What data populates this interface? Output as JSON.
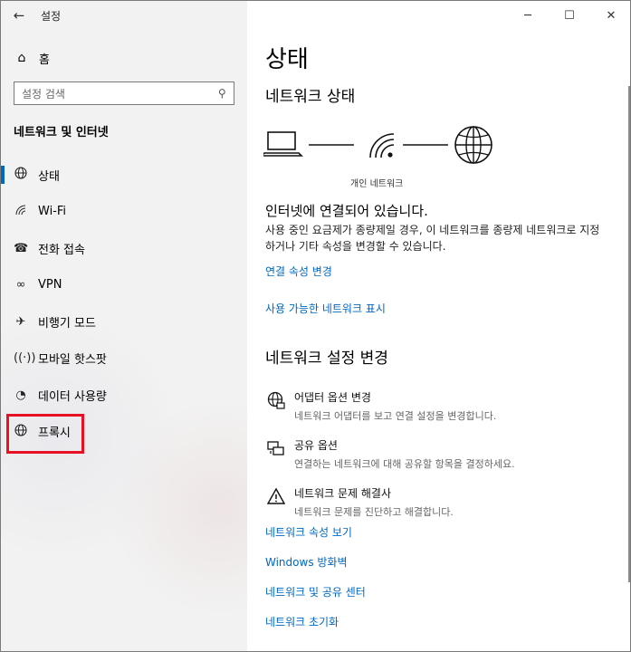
{
  "app": {
    "title": "설정"
  },
  "sidebar": {
    "home_label": "홈",
    "search_placeholder": "설정 검색",
    "section_title": "네트워크 및 인터넷",
    "items": [
      {
        "label": "상태",
        "icon": "globe-status-icon",
        "active": true
      },
      {
        "label": "Wi-Fi",
        "icon": "wifi-icon"
      },
      {
        "label": "전화 접속",
        "icon": "dialup-icon"
      },
      {
        "label": "VPN",
        "icon": "vpn-icon"
      },
      {
        "label": "비행기 모드",
        "icon": "airplane-icon"
      },
      {
        "label": "모바일 핫스팟",
        "icon": "hotspot-icon"
      },
      {
        "label": "데이터 사용량",
        "icon": "data-usage-icon"
      },
      {
        "label": "프록시",
        "icon": "globe-icon"
      }
    ]
  },
  "main": {
    "page_title": "상태",
    "network_status_heading": "네트워크 상태",
    "network_caption": "개인 네트워크",
    "connected_title": "인터넷에 연결되어 있습니다.",
    "connected_desc": "사용 중인 요금제가 종량제일 경우, 이 네트워크를 종량제 네트워크로 지정하거나 기타 속성을 변경할 수 있습니다.",
    "link_change_props": "연결 속성 변경",
    "link_show_networks": "사용 가능한 네트워크 표시",
    "change_settings_heading": "네트워크 설정 변경",
    "options": [
      {
        "title": "어댑터 옵션 변경",
        "desc": "네트워크 어댑터를 보고 연결 설정을 변경합니다.",
        "icon": "adapter-icon"
      },
      {
        "title": "공유 옵션",
        "desc": "연결하는 네트워크에 대해 공유할 항목을 결정하세요.",
        "icon": "sharing-icon"
      },
      {
        "title": "네트워크 문제 해결사",
        "desc": "네트워크 문제를 진단하고 해결합니다.",
        "icon": "warning-icon"
      }
    ],
    "bottom_links": [
      "네트워크 속성 보기",
      "Windows 방화벽",
      "네트워크 및 공유 센터",
      "네트워크 초기화"
    ]
  }
}
